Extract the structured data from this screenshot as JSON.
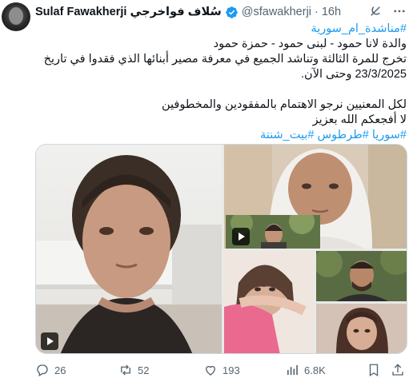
{
  "tweet": {
    "author_name": "Sulaf Fawakherji سُلاف فواخرجي",
    "handle": "@sfawakherji",
    "separator": "·",
    "time": "16h",
    "lines": [
      "#مناشدة_ام_سورية",
      "والدة لانا حمود - لبنى حمود - حمزة حمود",
      "تخرج للمرة الثالثة وتناشد الجميع في معرفة مصير أبنائها الذي فقدوا في تاريخ",
      "23/3/2025 وحتى الآن.",
      "",
      "لكل المعنيين نرجو الاهتمام بالمفقودين والمخطوفين",
      "لا أفجعكم الله بعزيز",
      "#سوريا #طرطوس #بيت_شنتة"
    ]
  },
  "actions": {
    "replies": "26",
    "reposts": "52",
    "likes": "193",
    "views": "6.8K"
  },
  "colors": {
    "accent": "#1d9bf0",
    "text": "#0f1419",
    "secondary": "#536471"
  },
  "icons": [
    "verified-icon",
    "grok-icon",
    "more-icon",
    "reply-icon",
    "repost-icon",
    "like-icon",
    "views-icon",
    "bookmark-icon",
    "share-icon",
    "play-icon"
  ]
}
